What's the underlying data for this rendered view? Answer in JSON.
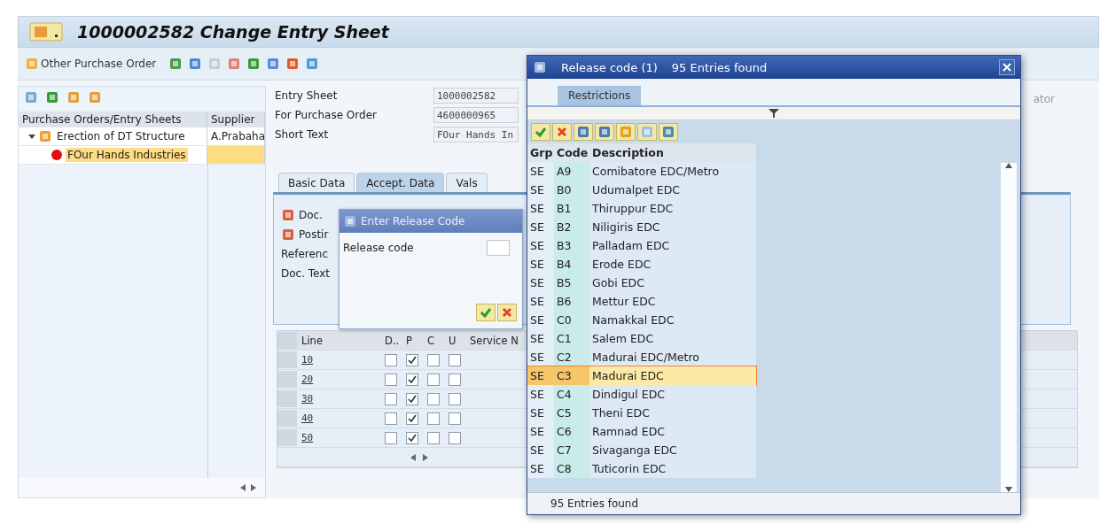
{
  "window": {
    "title": "1000002582 Change Entry Sheet"
  },
  "toolbar": {
    "other_po_button": "Other Purchase Order"
  },
  "tree": {
    "columns": [
      "Purchase Orders/Entry Sheets",
      "Supplier"
    ],
    "items": [
      {
        "label": "Erection of DT Structure",
        "supplier": "A.Prabaha",
        "expanded": true,
        "selected": false,
        "children": [
          {
            "label": "FOur Hands Industries",
            "selected": true
          }
        ]
      }
    ]
  },
  "header_fields": [
    {
      "label": "Entry Sheet",
      "value": "1000002582"
    },
    {
      "label": "For Purchase Order",
      "value": "4600000965"
    },
    {
      "label": "Short Text",
      "value": "FOur Hands In"
    }
  ],
  "tabs": [
    {
      "label": "Basic Data",
      "selected": false
    },
    {
      "label": "Accept. Data",
      "selected": true
    },
    {
      "label": "Vals",
      "selected": false
    }
  ],
  "accept_fields": [
    {
      "label": "Doc.",
      "kind": "icon"
    },
    {
      "label": "Postir",
      "kind": "icon"
    },
    {
      "label": "Referenc",
      "kind": "plain"
    },
    {
      "label": "Doc. Text",
      "kind": "plain"
    }
  ],
  "lines": {
    "columns": [
      "Line",
      "D..",
      "P",
      "C",
      "U",
      "Service N"
    ],
    "rows": [
      {
        "line": "10",
        "d": false,
        "p": true,
        "c": false,
        "u": false
      },
      {
        "line": "20",
        "d": false,
        "p": true,
        "c": false,
        "u": false
      },
      {
        "line": "30",
        "d": false,
        "p": true,
        "c": false,
        "u": false
      },
      {
        "line": "40",
        "d": false,
        "p": true,
        "c": false,
        "u": false
      },
      {
        "line": "50",
        "d": false,
        "p": true,
        "c": false,
        "u": false
      }
    ]
  },
  "right_column_header": "ator",
  "release_dialog": {
    "title": "Enter Release Code",
    "field_label": "Release code"
  },
  "f4_dialog": {
    "title": "Release code (1)",
    "count": "95 Entries found",
    "tabs": [
      {
        "label": "Restrictions",
        "selected": true
      }
    ],
    "columns": [
      "Grp",
      "Code",
      "Description"
    ],
    "rows": [
      {
        "grp": "SE",
        "code": "A9",
        "description": "Comibatore EDC/Metro",
        "selected": false
      },
      {
        "grp": "SE",
        "code": "B0",
        "description": "Udumalpet EDC",
        "selected": false
      },
      {
        "grp": "SE",
        "code": "B1",
        "description": "Thiruppur EDC",
        "selected": false
      },
      {
        "grp": "SE",
        "code": "B2",
        "description": "Niligiris EDC",
        "selected": false
      },
      {
        "grp": "SE",
        "code": "B3",
        "description": "Palladam EDC",
        "selected": false
      },
      {
        "grp": "SE",
        "code": "B4",
        "description": "Erode EDC",
        "selected": false
      },
      {
        "grp": "SE",
        "code": "B5",
        "description": "Gobi EDC",
        "selected": false
      },
      {
        "grp": "SE",
        "code": "B6",
        "description": "Mettur EDC",
        "selected": false
      },
      {
        "grp": "SE",
        "code": "C0",
        "description": "Namakkal EDC",
        "selected": false
      },
      {
        "grp": "SE",
        "code": "C1",
        "description": "Salem EDC",
        "selected": false
      },
      {
        "grp": "SE",
        "code": "C2",
        "description": "Madurai EDC/Metro",
        "selected": false
      },
      {
        "grp": "SE",
        "code": "C3",
        "description": "Madurai EDC",
        "selected": true
      },
      {
        "grp": "SE",
        "code": "C4",
        "description": "Dindigul EDC",
        "selected": false
      },
      {
        "grp": "SE",
        "code": "C5",
        "description": "Theni EDC",
        "selected": false
      },
      {
        "grp": "SE",
        "code": "C6",
        "description": "Ramnad EDC",
        "selected": false
      },
      {
        "grp": "SE",
        "code": "C7",
        "description": "Sivaganga EDC",
        "selected": false
      },
      {
        "grp": "SE",
        "code": "C8",
        "description": "Tuticorin EDC",
        "selected": false
      }
    ],
    "footer": "95 Entries found"
  }
}
